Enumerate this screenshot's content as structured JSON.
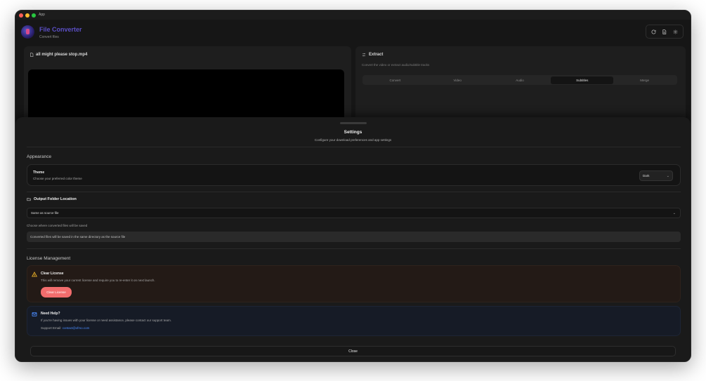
{
  "window": {
    "title": "App"
  },
  "header": {
    "app_name": "File Converter",
    "app_subtitle": "Convert files",
    "buttons": [
      {
        "icon": "refresh-icon"
      },
      {
        "icon": "document-icon"
      },
      {
        "icon": "gear-icon"
      }
    ]
  },
  "left_panel": {
    "file_name": "all might please stop.mp4"
  },
  "right_panel": {
    "title": "Extract",
    "subtitle": "Convert the video or extract audio/subtitle tracks",
    "tabs": [
      "Convert",
      "Video",
      "Audio",
      "Subtitles",
      "Merge"
    ],
    "active_tab": "Subtitles"
  },
  "settings": {
    "title": "Settings",
    "subtitle": "Configure your download preferences and app settings",
    "appearance": {
      "section_label": "Appearance",
      "theme_title": "Theme",
      "theme_desc": "Choose your preferred color theme",
      "theme_value": "Dark"
    },
    "output_folder": {
      "title": "Output Folder Location",
      "selected": "Same as source file",
      "help": "Choose where converted files will be saved",
      "info": "Converted files will be saved in the same directory as the source file"
    },
    "license": {
      "section_label": "License Management",
      "clear_title": "Clear License",
      "clear_desc": "This will remove your current license and require you to re-enter it on next launch.",
      "clear_button": "Clear License",
      "help_title": "Need Help?",
      "help_desc": "If you're having issues with your license or need assistance, please contact our support team.",
      "support_label": "Support Email:",
      "support_email": "contact@xfmo.com"
    },
    "close_button": "Close"
  },
  "colors": {
    "accent": "#5b4fc4",
    "danger_button": "#f26d6d",
    "link": "#4b8cff",
    "warning_icon": "#f0b429"
  }
}
